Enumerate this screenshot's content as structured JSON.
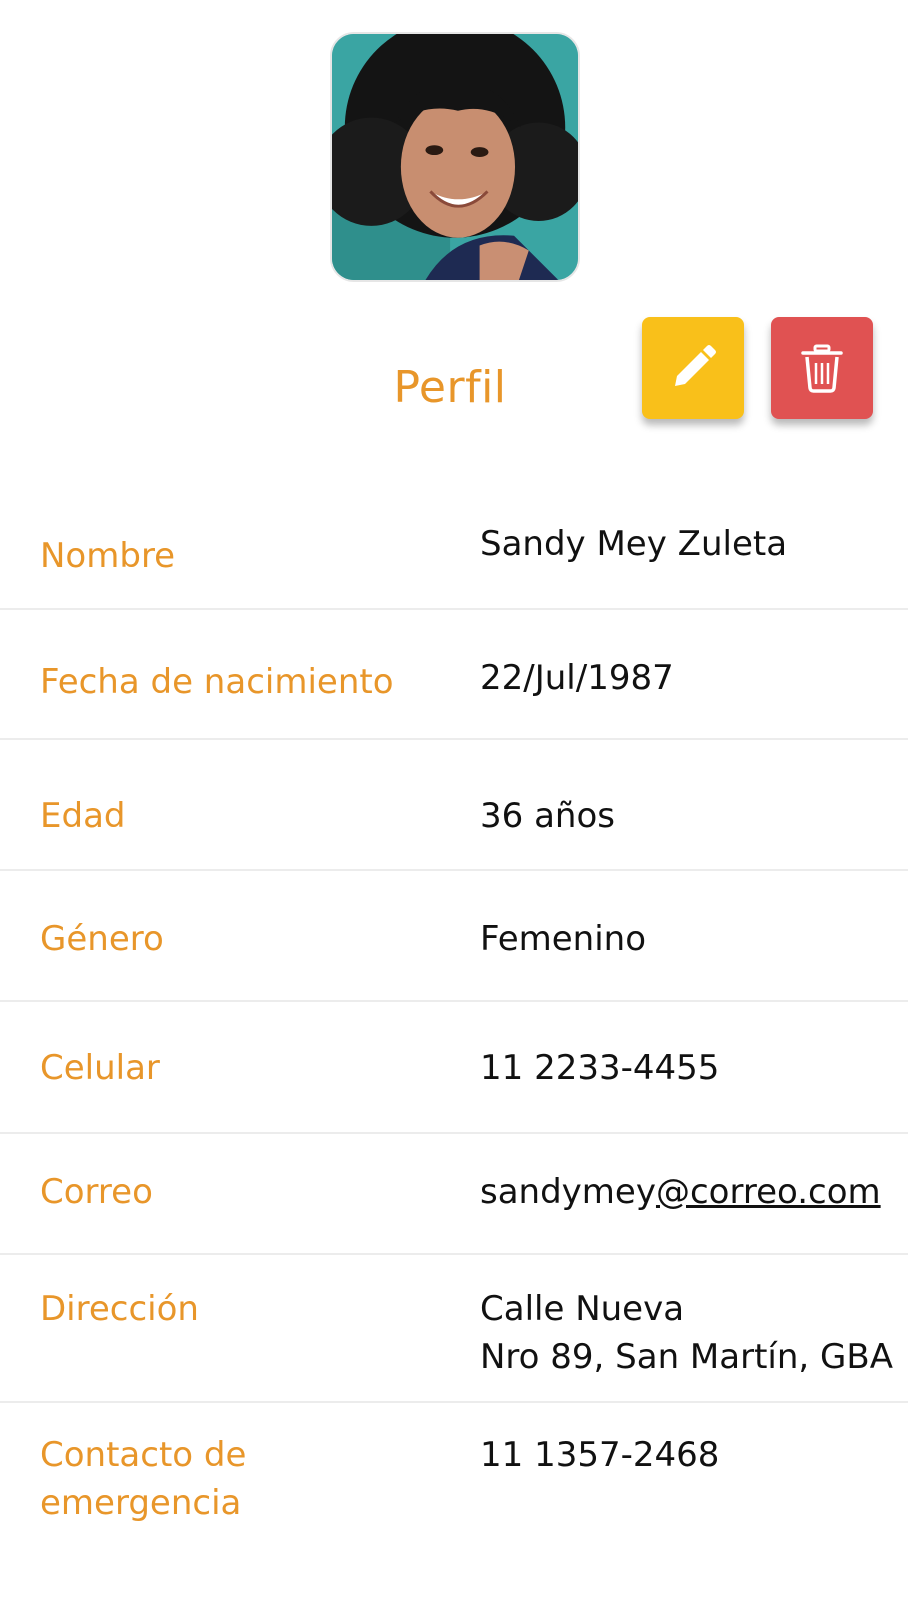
{
  "header": {
    "title": "Perfil",
    "edit_icon": "pencil-icon",
    "delete_icon": "trash-icon",
    "edit_color": "#f9c01a",
    "delete_color": "#e05252",
    "accent_color": "#e8962a"
  },
  "profile": {
    "fields": [
      {
        "label": "Nombre",
        "value": "Sandy Mey Zuleta"
      },
      {
        "label": "Fecha de nacimiento",
        "value": "22/Jul/1987"
      },
      {
        "label": "Edad",
        "value": "36 años"
      },
      {
        "label": "Género",
        "value": "Femenino"
      },
      {
        "label": "Celular",
        "value": "11 2233-4455"
      },
      {
        "label": "Correo",
        "value_user": "sandymey",
        "value_domain": "@correo.com"
      },
      {
        "label": "Dirección",
        "value_line1": "Calle Nueva",
        "value_line2": "Nro 89, San Martín, GBA"
      },
      {
        "label_line1": "Contacto de",
        "label_line2": "emergencia",
        "value": "11 1357-2468"
      }
    ]
  }
}
